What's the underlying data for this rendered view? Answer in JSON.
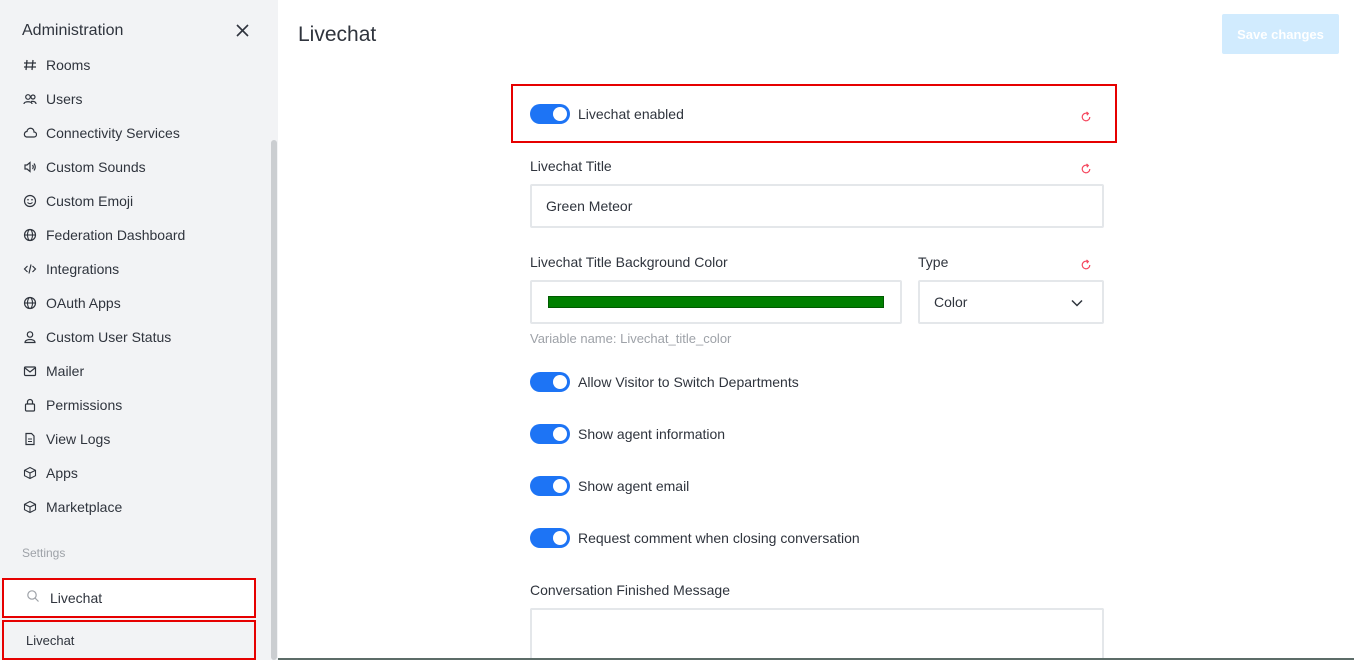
{
  "sidebar": {
    "title": "Administration",
    "items": [
      {
        "label": "Rooms",
        "icon": "hashtag-icon"
      },
      {
        "label": "Users",
        "icon": "team-icon"
      },
      {
        "label": "Connectivity Services",
        "icon": "cloud-icon"
      },
      {
        "label": "Custom Sounds",
        "icon": "volume-icon"
      },
      {
        "label": "Custom Emoji",
        "icon": "emoji-icon"
      },
      {
        "label": "Federation Dashboard",
        "icon": "globe-icon"
      },
      {
        "label": "Integrations",
        "icon": "code-icon"
      },
      {
        "label": "OAuth Apps",
        "icon": "globe-icon"
      },
      {
        "label": "Custom User Status",
        "icon": "user-icon"
      },
      {
        "label": "Mailer",
        "icon": "mail-icon"
      },
      {
        "label": "Permissions",
        "icon": "lock-icon"
      },
      {
        "label": "View Logs",
        "icon": "file-icon"
      },
      {
        "label": "Apps",
        "icon": "cube-icon"
      },
      {
        "label": "Marketplace",
        "icon": "cube-icon"
      }
    ],
    "settings_label": "Settings",
    "search_value": "Livechat",
    "search_result": "Livechat"
  },
  "main": {
    "title": "Livechat",
    "save_label": "Save changes",
    "livechat_enabled_label": "Livechat enabled",
    "livechat_title_label": "Livechat Title",
    "livechat_title_value": "Green Meteor",
    "bg_color_label": "Livechat Title Background Color",
    "bg_color_value": "#008000",
    "type_label": "Type",
    "type_value": "Color",
    "variable_hint": "Variable name: Livechat_title_color",
    "toggles": [
      {
        "label": "Allow Visitor to Switch Departments",
        "on": true
      },
      {
        "label": "Show agent information",
        "on": true
      },
      {
        "label": "Show agent email",
        "on": true
      },
      {
        "label": "Request comment when closing conversation",
        "on": true
      }
    ],
    "finished_message_label": "Conversation Finished Message"
  },
  "colors": {
    "accent": "#1d74f5",
    "highlight": "#e60000",
    "reset": "#f5455c",
    "sidebar_bg": "#f2f3f5"
  }
}
